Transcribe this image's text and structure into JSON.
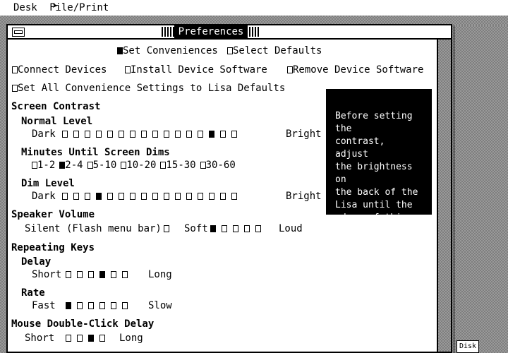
{
  "menubar": {
    "desk": "Desk",
    "file_print": "File/Print"
  },
  "window": {
    "title": "Preferences"
  },
  "modes": {
    "set_conveniences": "Set Conveniences",
    "select_defaults": "Select Defaults",
    "connect_devices": "Connect Devices",
    "install_device_software": "Install Device Software",
    "remove_device_software": "Remove Device Software",
    "set_all_defaults": "Set All Convenience Settings to Lisa Defaults",
    "selected_mode": "Set Conveniences"
  },
  "screen_contrast": {
    "heading": "Screen Contrast",
    "normal_level": {
      "label": "Normal Level",
      "low": "Dark",
      "high": "Bright",
      "steps": 16,
      "selected_index": 13
    },
    "minutes_label": "Minutes Until Screen Dims",
    "minutes_options": [
      "1-2",
      "2-4",
      "5-10",
      "10-20",
      "15-30",
      "30-60"
    ],
    "minutes_selected": "2-4",
    "dim_level": {
      "label": "Dim Level",
      "low": "Dark",
      "high": "Bright",
      "steps": 16,
      "selected_index": 3
    }
  },
  "speaker_volume": {
    "heading": "Speaker Volume",
    "silent_label": "Silent (Flash menu bar)",
    "soft_label": "Soft",
    "loud_label": "Loud",
    "steps": 5,
    "selected_index": 0
  },
  "repeating_keys": {
    "heading": "Repeating Keys",
    "delay": {
      "label": "Delay",
      "low": "Short",
      "high": "Long",
      "steps": 6,
      "selected_index": 3
    },
    "rate": {
      "label": "Rate",
      "low": "Fast",
      "high": "Slow",
      "steps": 6,
      "selected_index": 0
    }
  },
  "mouse": {
    "heading": "Mouse Double-Click Delay",
    "low": "Short",
    "high": "Long",
    "steps": 4,
    "selected_index": 2
  },
  "info_box": {
    "text": "Before setting the\ncontrast, adjust\nthe brightness on\nthe back of the\nLisa until the\nedges of this box\nare sharp."
  },
  "desktop": {
    "disk_label": "Disk"
  },
  "colors": {
    "foreground": "#000000",
    "background": "#ffffff",
    "desktop": "#8f8f8f"
  }
}
